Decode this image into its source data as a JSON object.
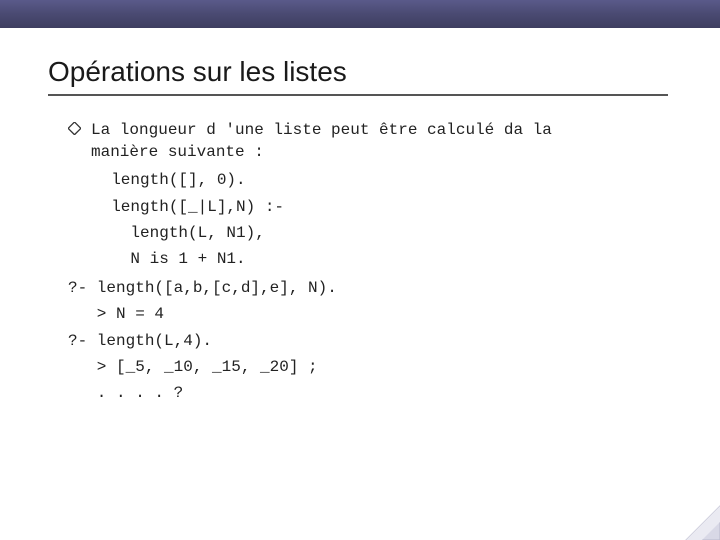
{
  "title": "Opérations sur les listes",
  "intro": "La longueur d 'une liste peut être calculé da la\nmanière suivante :",
  "code": "  length([], 0).\n  length([_|L],N) :-\n    length(L, N1),\n    N is 1 + N1.",
  "queries": "?- length([a,b,[c,d],e], N).\n   > N = 4\n?- length(L,4).\n   > [_5, _10, _15, _20] ;\n   . . . . ?"
}
